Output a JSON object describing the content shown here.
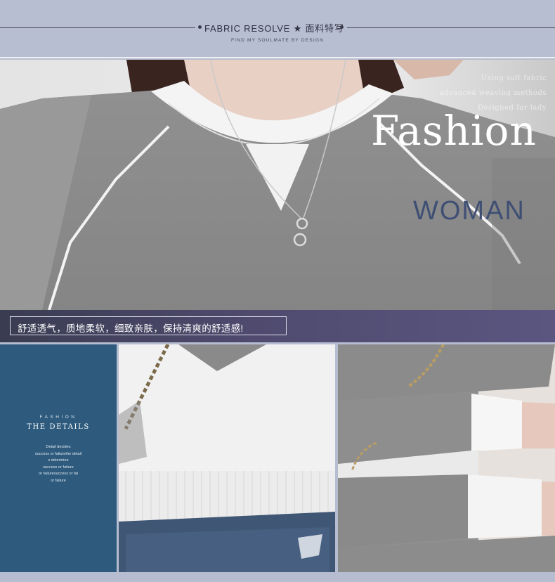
{
  "header": {
    "title": "FABRIC RESOLVE ★ 面料特写",
    "subtitle": "FIND MY SOULMATE BY DESIGN"
  },
  "hero": {
    "copy_lines": [
      "Using soft fabric",
      "advanced weaving methods",
      "Designed for lady"
    ],
    "headline": "Fashion",
    "subheadline": "WOMAN"
  },
  "caption": {
    "text": "舒适透气，质地柔软，细致亲肤，保持清爽的舒适感!"
  },
  "details": {
    "small_label": "FASHION",
    "title": "THE DETAILS",
    "lines": [
      "Detail decides",
      "success or failurethe detail",
      "s determine",
      "success or failure",
      "or failuresuccess or fai",
      "or failure"
    ]
  },
  "colors": {
    "header_bg": "#b8bed2",
    "caption_bg": "#4f4a6e",
    "details_panel": "#2d5a7d",
    "sweater_gray": "#8e8e8e",
    "woman_text": "#3f4f74"
  }
}
